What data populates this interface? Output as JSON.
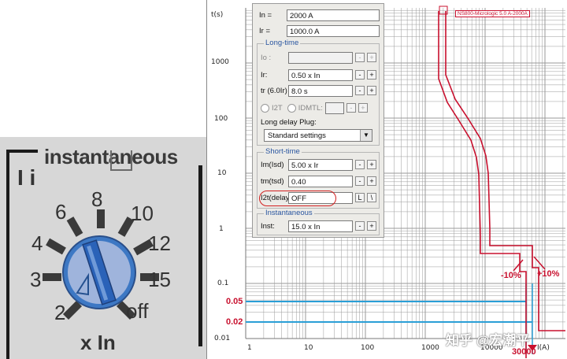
{
  "dial": {
    "title": "instantaneous",
    "symbol": "I i",
    "unit": "x In",
    "positions": [
      "2",
      "3",
      "4",
      "6",
      "8",
      "10",
      "12",
      "15",
      "off"
    ],
    "colors": {
      "knob": "#3d78c4",
      "knob_light": "#9fb4dc",
      "panel": "#d7d7d7",
      "tick": "#3a3a3a"
    }
  },
  "chart": {
    "y_axis_label": "t(s)",
    "y_ticks": [
      "1000",
      "100",
      "10",
      "1",
      "0.1",
      "0.01"
    ],
    "x_axis_label": "I(A)",
    "x_ticks": [
      "1",
      "10",
      "100",
      "1000",
      "10000"
    ],
    "curve_tag": "NS800-Micrologic 5.0 A-2000A",
    "annotations": {
      "minus_tolerance": "-10%",
      "plus_tolerance": "+10%",
      "current_marker": "30000",
      "time_05": "0.05",
      "time_02": "0.02"
    },
    "colors": {
      "curve": "#c8102e",
      "marker": "#2a9fd6",
      "grid": "#9a9a9a"
    },
    "watermark": "知乎 @宏潮平"
  },
  "dialog": {
    "in_label": "In =",
    "in_value": "2000 A",
    "ir_label": "Ir =",
    "ir_value": "1000.0 A",
    "long_time": {
      "title": "Long-time",
      "io_label": "Io :",
      "io_value": "",
      "ir_label": "Ir:",
      "ir_value": "0.50 x In",
      "tr_label": "tr (6.0Ir)",
      "tr_value": "8.0 s",
      "radio_i2t": "I2T",
      "radio_idmtl": "IDMTL:",
      "plug_label": "Long delay Plug:",
      "plug_value": "Standard settings"
    },
    "short_time": {
      "title": "Short-time",
      "im_label": "Im(Isd)",
      "im_value": "5.00 x Ir",
      "tm_label": "tm(tsd)",
      "tm_value": "0.40",
      "i2t_label": "I2t(delay",
      "i2t_value": "OFF",
      "l_button": "L",
      "slash_button": "\\"
    },
    "instantaneous": {
      "title": "Instantaneous",
      "inst_label": "Inst:",
      "inst_value": "15.0 x In"
    },
    "minus": "-",
    "plus": "+"
  }
}
